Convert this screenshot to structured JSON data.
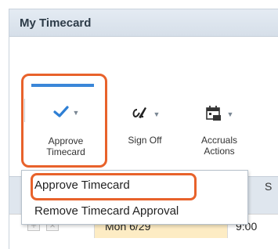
{
  "window": {
    "title": "My Timecard"
  },
  "toolbar": {
    "approve": {
      "icon": "checkmark-icon",
      "line1": "Approve",
      "line2": "Timecard"
    },
    "sign_off": {
      "icon": "signature-icon",
      "label": "Sign Off"
    },
    "accruals": {
      "icon": "calendar-icon",
      "line1": "Accruals",
      "line2": "Actions"
    }
  },
  "menu": {
    "items": [
      "Approve Timecard",
      "Remove Timecard Approval"
    ]
  },
  "grid": {
    "header_partial": "S",
    "row": {
      "date": "Mon 6/29",
      "time": "9:00"
    }
  },
  "colors": {
    "highlight": "#e8622b",
    "accent": "#3a86d8",
    "date_bg": "#fdecc4"
  }
}
